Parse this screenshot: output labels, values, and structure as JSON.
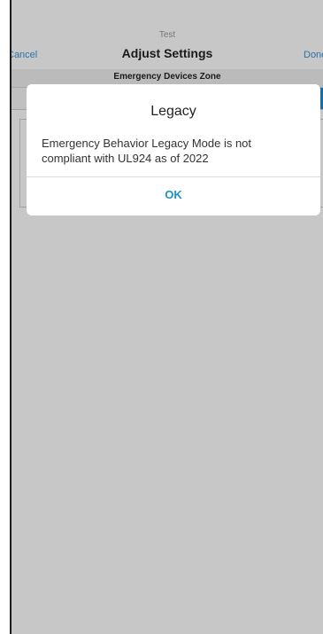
{
  "nav": {
    "subtitle": "Test",
    "title": "Adjust Settings",
    "cancel_label": "Cancel",
    "done_label": "Done"
  },
  "section": {
    "header": "Emergency Devices Zone"
  },
  "alert": {
    "title": "Legacy",
    "message": "Emergency Behavior Legacy Mode is not compliant with UL924 as of 2022",
    "ok_label": "OK"
  },
  "colors": {
    "accent": "#1e8fd0",
    "link": "#3a92d6",
    "overlay": "rgba(0,0,0,0.22)"
  }
}
